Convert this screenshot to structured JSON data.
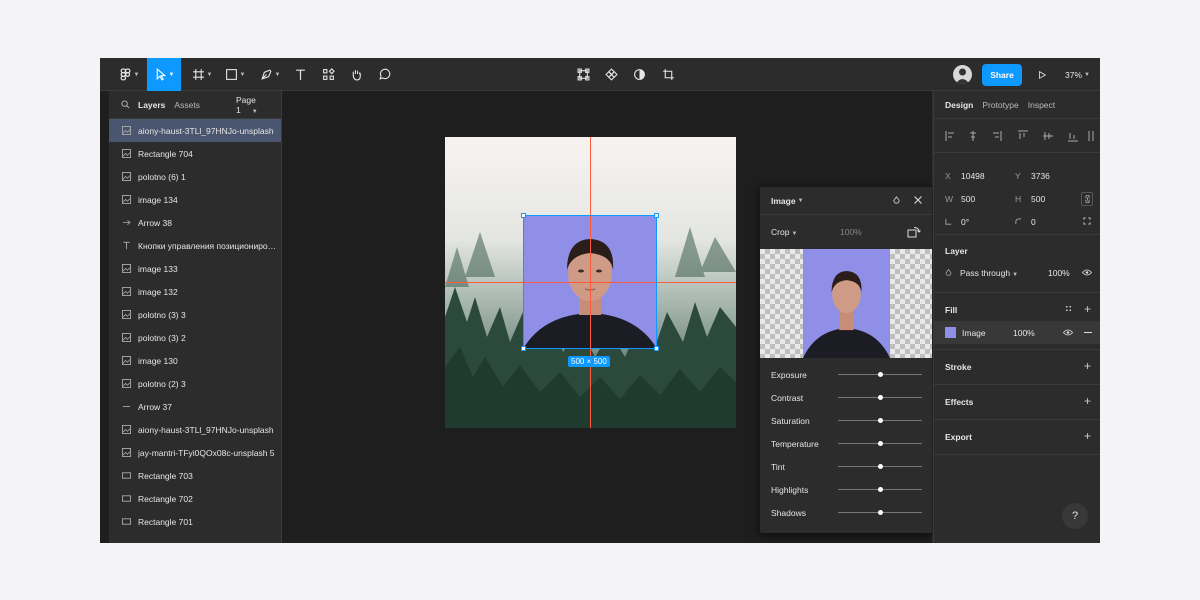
{
  "toolbar": {
    "tools": [
      "main-menu",
      "move-tool",
      "frame-tool",
      "shape-tool",
      "pen-tool",
      "text-tool",
      "resources-tool",
      "hand-tool",
      "comment-tool"
    ],
    "center_tools": [
      "crop-mode-icon",
      "component-icon",
      "mask-icon",
      "crop-icon"
    ],
    "share_label": "Share",
    "zoom": "37%"
  },
  "left_panel": {
    "tabs": [
      "Layers",
      "Assets"
    ],
    "page": "Page 1",
    "layers": [
      {
        "name": "aiony-haust-3TLl_97HNJo-unsplash",
        "icon": "image"
      },
      {
        "name": "Rectangle 704",
        "icon": "image"
      },
      {
        "name": "polotno (6) 1",
        "icon": "image"
      },
      {
        "name": "image 134",
        "icon": "image"
      },
      {
        "name": "Arrow 38",
        "icon": "arrow"
      },
      {
        "name": "Кнопки управления позиционированием",
        "icon": "text"
      },
      {
        "name": "image 133",
        "icon": "image"
      },
      {
        "name": "image 132",
        "icon": "image"
      },
      {
        "name": "polotno (3) 3",
        "icon": "image"
      },
      {
        "name": "polotno (3) 2",
        "icon": "image"
      },
      {
        "name": "image 130",
        "icon": "image"
      },
      {
        "name": "polotno (2) 3",
        "icon": "image"
      },
      {
        "name": "Arrow 37",
        "icon": "line"
      },
      {
        "name": "aiony-haust-3TLl_97HNJo-unsplash",
        "icon": "image"
      },
      {
        "name": "jay-mantri-TFyi0QOx08c-unsplash 5",
        "icon": "image"
      },
      {
        "name": "Rectangle 703",
        "icon": "rect"
      },
      {
        "name": "Rectangle 702",
        "icon": "rect"
      },
      {
        "name": "Rectangle 701",
        "icon": "rect"
      }
    ]
  },
  "canvas": {
    "selection_size": "500 × 500"
  },
  "image_popup": {
    "title": "Image",
    "mode": "Crop",
    "percent": "100%",
    "adjustments": [
      {
        "label": "Exposure",
        "value": 0.5
      },
      {
        "label": "Contrast",
        "value": 0.5
      },
      {
        "label": "Saturation",
        "value": 0.5
      },
      {
        "label": "Temperature",
        "value": 0.5
      },
      {
        "label": "Tint",
        "value": 0.5
      },
      {
        "label": "Highlights",
        "value": 0.5
      },
      {
        "label": "Shadows",
        "value": 0.5
      }
    ]
  },
  "right_panel": {
    "tabs": [
      "Design",
      "Prototype",
      "Inspect"
    ],
    "x_label": "X",
    "x": "10498",
    "y_label": "Y",
    "y": "3736",
    "w_label": "W",
    "w": "500",
    "h_label": "H",
    "h": "500",
    "rotation": "0°",
    "radius": "0",
    "layer_title": "Layer",
    "blend": "Pass through",
    "opacity": "100%",
    "fill_title": "Fill",
    "fill_name": "Image",
    "fill_opacity": "100%",
    "stroke_title": "Stroke",
    "effects_title": "Effects",
    "export_title": "Export"
  },
  "help_label": "?",
  "colors": {
    "accent": "#0d99ff",
    "selection": "#4a5670",
    "guide": "#ff5a3c"
  }
}
